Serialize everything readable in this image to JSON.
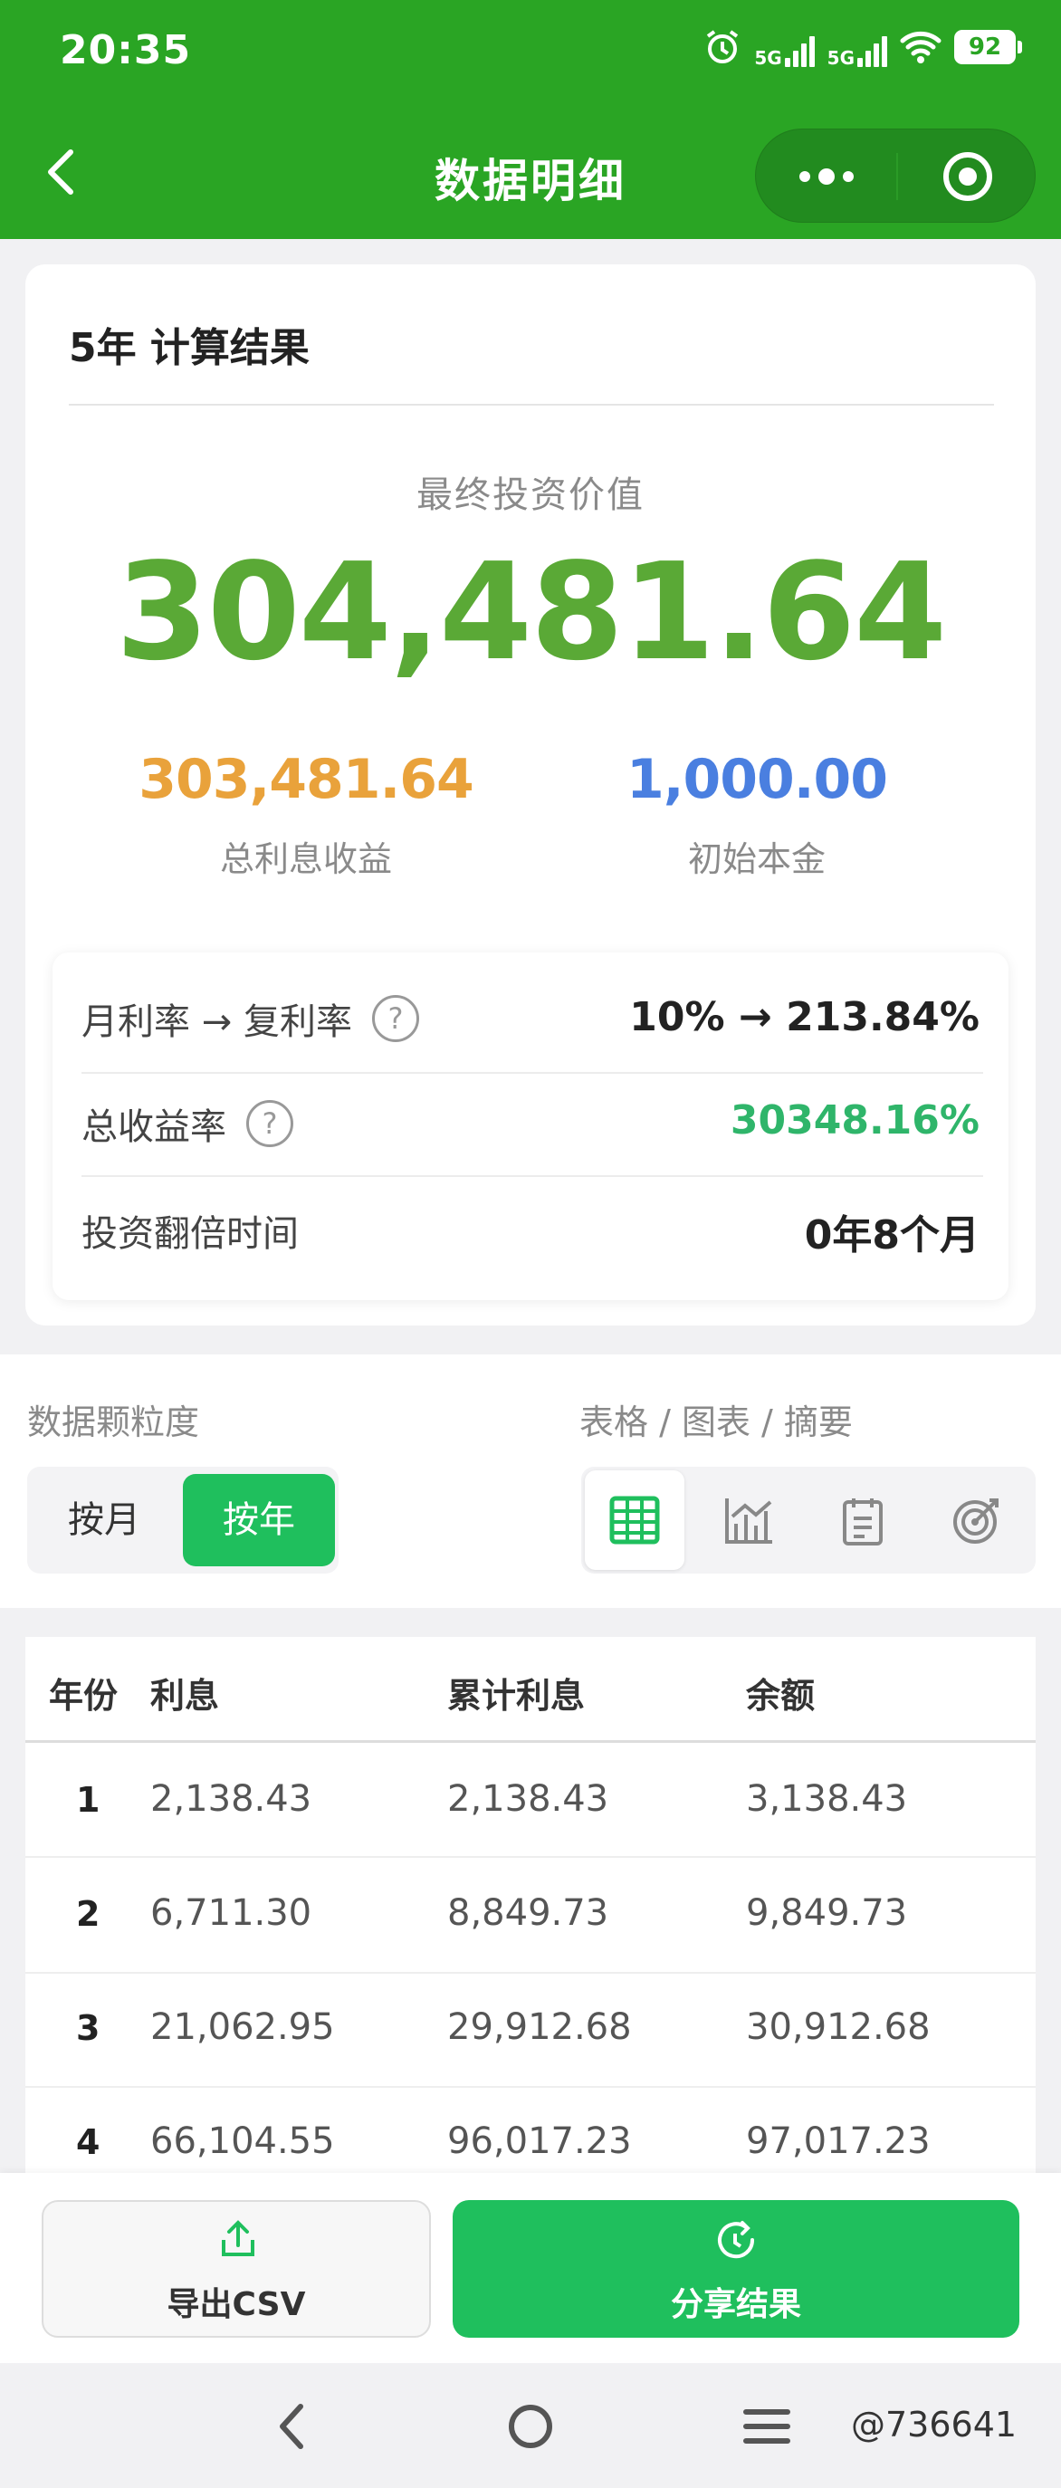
{
  "status_bar": {
    "time": "20:35",
    "network1": "5G",
    "network2": "5G",
    "battery": "92"
  },
  "nav": {
    "title": "数据明细"
  },
  "result": {
    "title": "5年 计算结果",
    "final_label": "最终投资价值",
    "final_value": "304,481.64",
    "interest_value": "303,481.64",
    "interest_label": "总利息收益",
    "principal_value": "1,000.00",
    "principal_label": "初始本金",
    "rows": [
      {
        "label": "月利率 → 复利率",
        "has_help": true,
        "value": "10% → 213.84%"
      },
      {
        "label": "总收益率",
        "has_help": true,
        "value": "30348.16%"
      },
      {
        "label": "投资翻倍时间",
        "has_help": false,
        "value": "0年8个月"
      }
    ],
    "help_glyph": "?"
  },
  "controls": {
    "granularity_label": "数据颗粒度",
    "view_label": "表格 / 图表 / 摘要",
    "granularity_options": [
      "按月",
      "按年"
    ],
    "selected_granularity": "按年",
    "view_icons": [
      "table-icon",
      "chart-icon",
      "clipboard-icon",
      "target-icon"
    ],
    "selected_view": "table-icon"
  },
  "table": {
    "headers": [
      "年份",
      "利息",
      "累计利息",
      "余额"
    ],
    "rows": [
      [
        "1",
        "2,138.43",
        "2,138.43",
        "3,138.43"
      ],
      [
        "2",
        "6,711.30",
        "8,849.73",
        "9,849.73"
      ],
      [
        "3",
        "21,062.95",
        "29,912.68",
        "30,912.68"
      ],
      [
        "4",
        "66,104.55",
        "96,017.23",
        "97,017.23"
      ]
    ]
  },
  "actions": {
    "export_label": "导出CSV",
    "share_label": "分享结果"
  },
  "watermark": "@736641",
  "colors": {
    "nav_green": "#2aa524",
    "final_value": "#5aa936",
    "interest": "#e9a23b",
    "principal": "#4a7fe0",
    "rate_green": "#2fb56a",
    "share_button": "#1fbf5d"
  }
}
